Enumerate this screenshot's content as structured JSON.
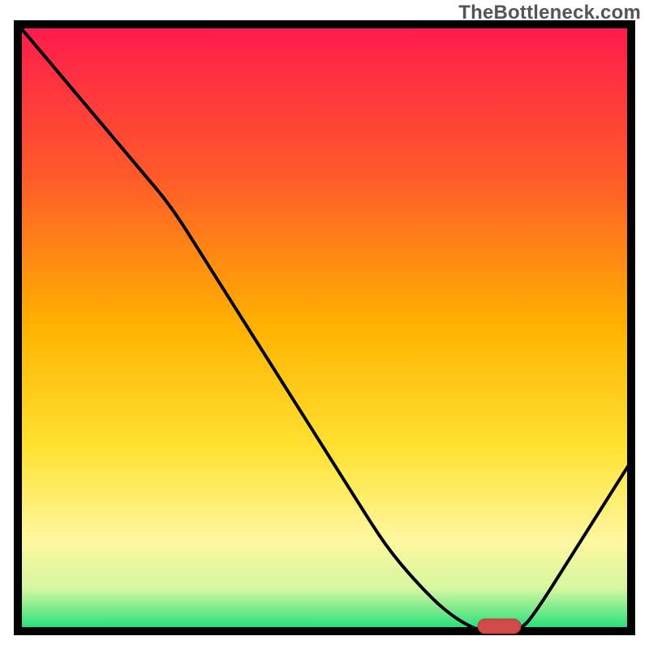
{
  "watermark": "TheBottleneck.com",
  "chart_data": {
    "type": "line",
    "title": "",
    "xlabel": "",
    "ylabel": "",
    "xlim": [
      0,
      100
    ],
    "ylim": [
      0,
      100
    ],
    "x": [
      0,
      5,
      10,
      15,
      20,
      25,
      30,
      35,
      40,
      45,
      50,
      55,
      60,
      65,
      70,
      75,
      78,
      82,
      85,
      90,
      95,
      100
    ],
    "values": [
      100,
      94,
      88,
      82,
      76,
      70,
      62,
      54,
      46,
      38,
      30,
      22,
      14,
      8,
      3,
      0,
      0,
      0,
      4,
      12,
      20,
      28
    ],
    "marker": {
      "x_start": 75,
      "x_end": 82,
      "y": 0
    },
    "gradient_stops": [
      {
        "offset": 0.0,
        "color": "#ff1a4d"
      },
      {
        "offset": 0.25,
        "color": "#ff5a2a"
      },
      {
        "offset": 0.5,
        "color": "#ffb300"
      },
      {
        "offset": 0.7,
        "color": "#ffe233"
      },
      {
        "offset": 0.85,
        "color": "#fff7a0"
      },
      {
        "offset": 0.93,
        "color": "#d4f7a0"
      },
      {
        "offset": 0.97,
        "color": "#6be88a"
      },
      {
        "offset": 1.0,
        "color": "#13e07a"
      }
    ],
    "colors": {
      "border": "#000000",
      "curve": "#000000",
      "marker_fill": "#d14a4a",
      "marker_stroke": "#b93838"
    }
  }
}
